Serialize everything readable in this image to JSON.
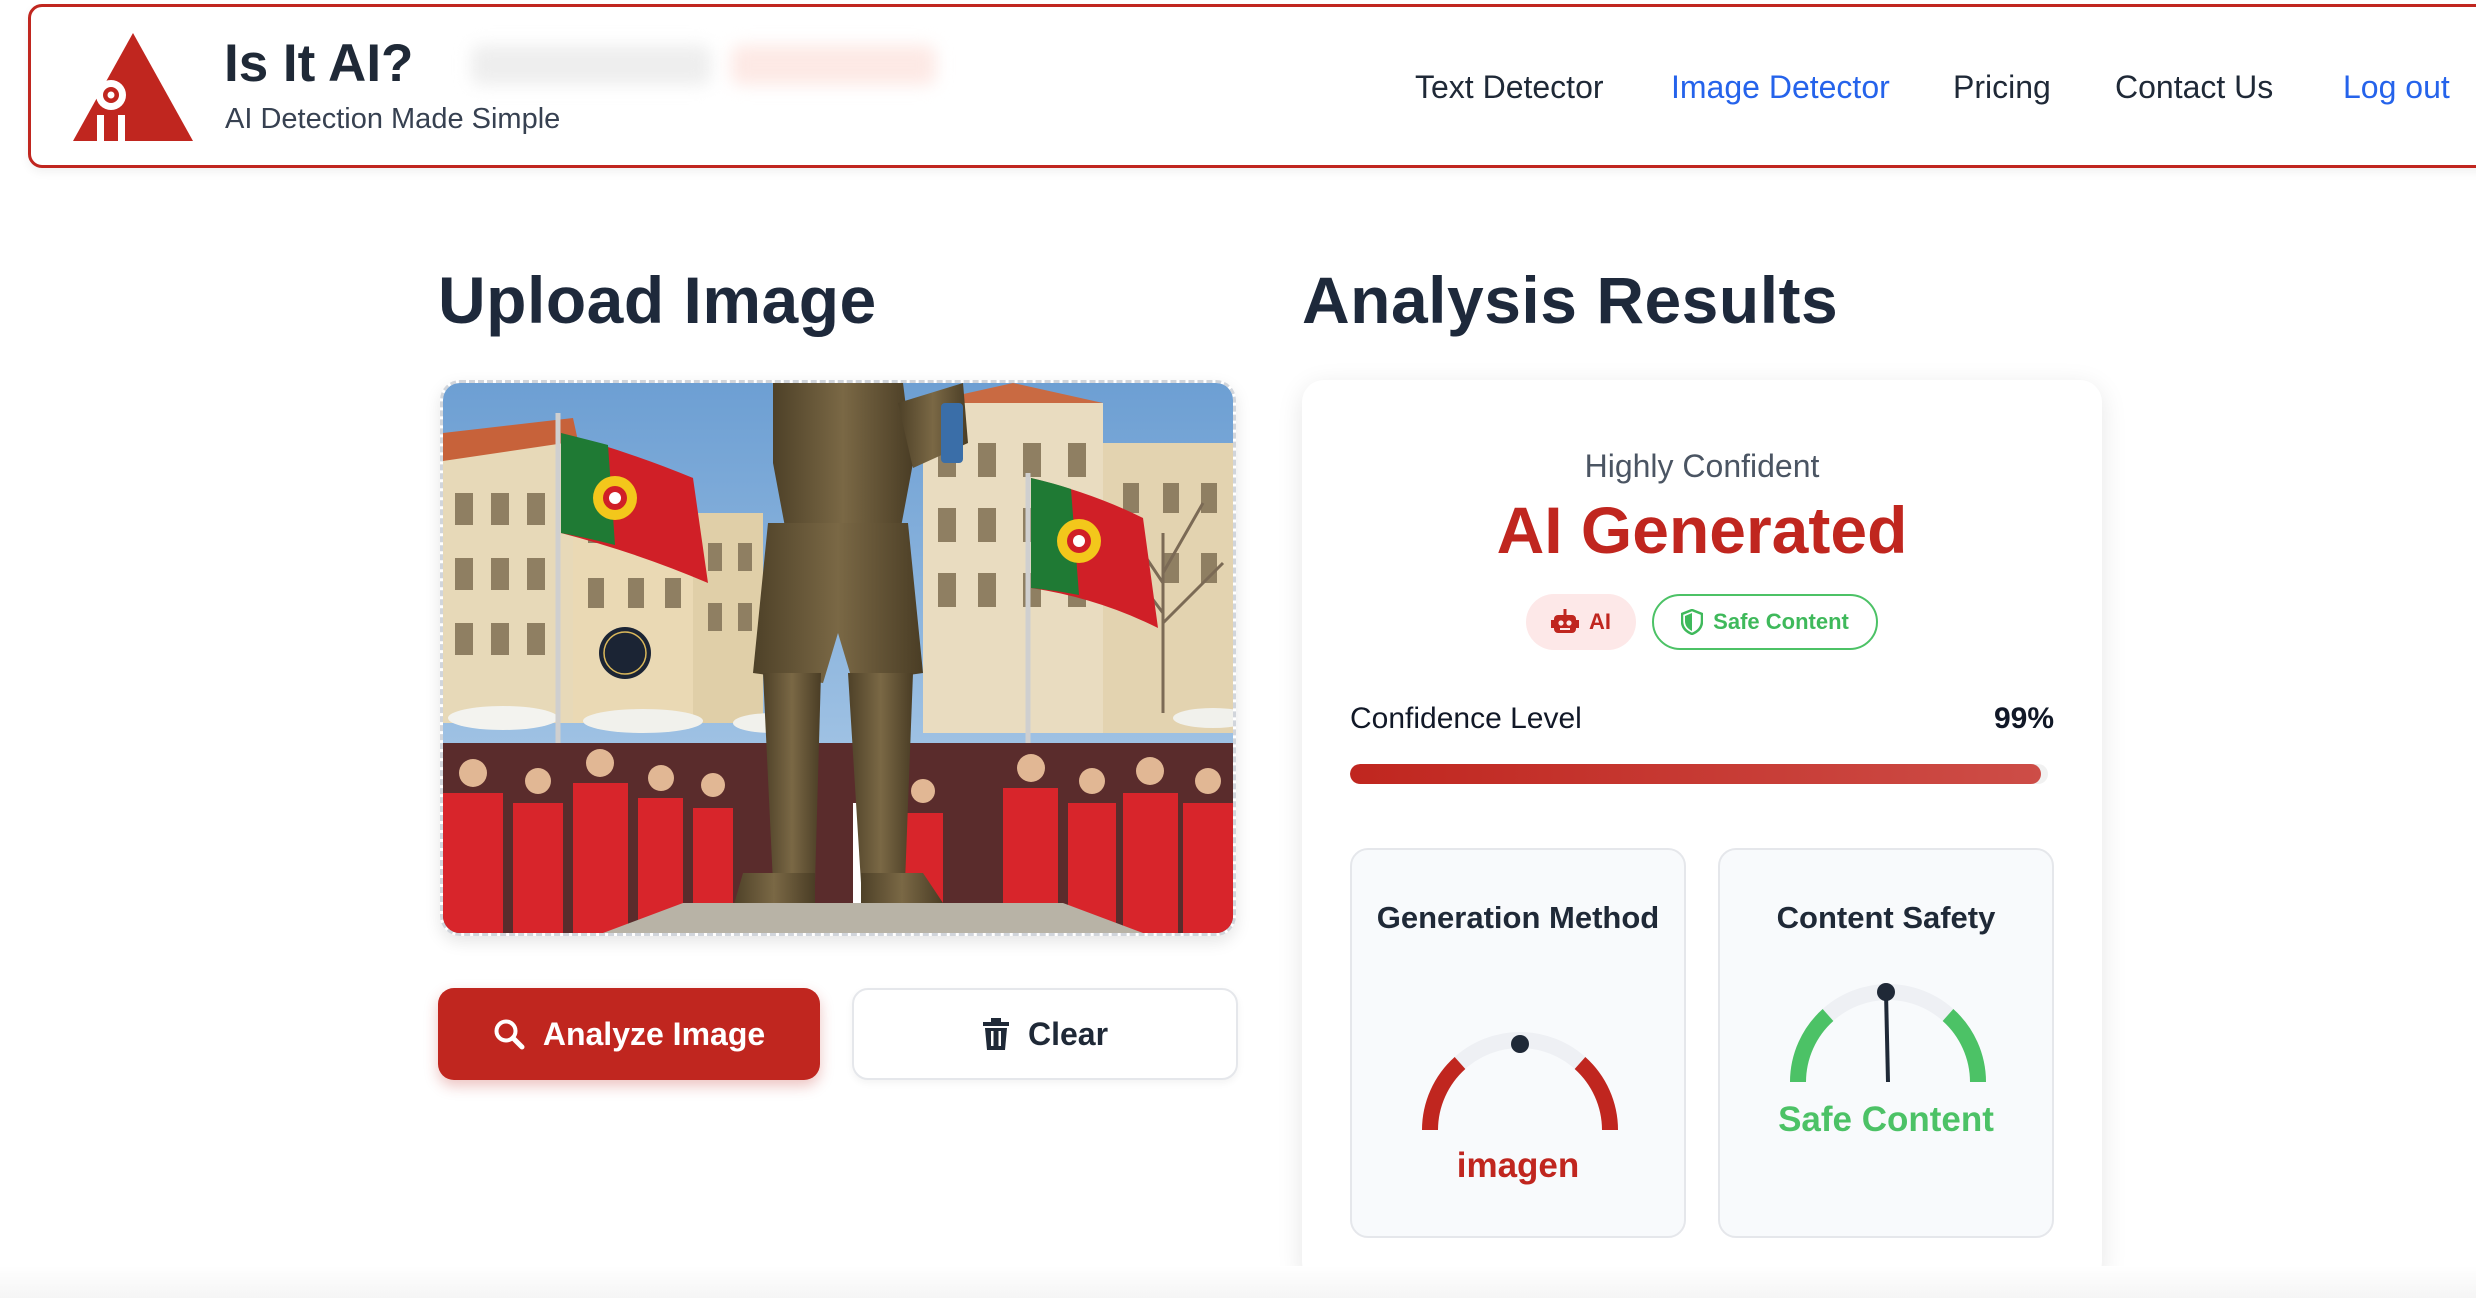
{
  "header": {
    "brand_title": "Is It AI?",
    "brand_subtitle": "AI Detection Made Simple",
    "nav": {
      "text_detector": "Text Detector",
      "image_detector": "Image Detector",
      "pricing": "Pricing",
      "contact_us": "Contact Us",
      "log_out": "Log out"
    },
    "active_nav": "Image Detector"
  },
  "upload": {
    "title": "Upload Image",
    "analyze_label": "Analyze Image",
    "clear_label": "Clear",
    "analyze_icon": "search-icon",
    "clear_icon": "trash-icon"
  },
  "results": {
    "title": "Analysis Results",
    "confidence_label": "Highly Confident",
    "verdict": "AI Generated",
    "badges": [
      {
        "label": "AI",
        "icon": "robot-icon"
      },
      {
        "label": "Safe Content",
        "icon": "shield-icon"
      }
    ],
    "confidence_level_label": "Confidence Level",
    "confidence_level_value": "99%",
    "confidence_fraction": 0.99,
    "generation_method": {
      "title": "Generation Method",
      "value": "imagen"
    },
    "content_safety": {
      "title": "Content Safety",
      "value": "Safe Content"
    }
  },
  "colors": {
    "brand_red": "#c0261f",
    "link_blue": "#2563eb",
    "safe_green": "#4cc266"
  }
}
